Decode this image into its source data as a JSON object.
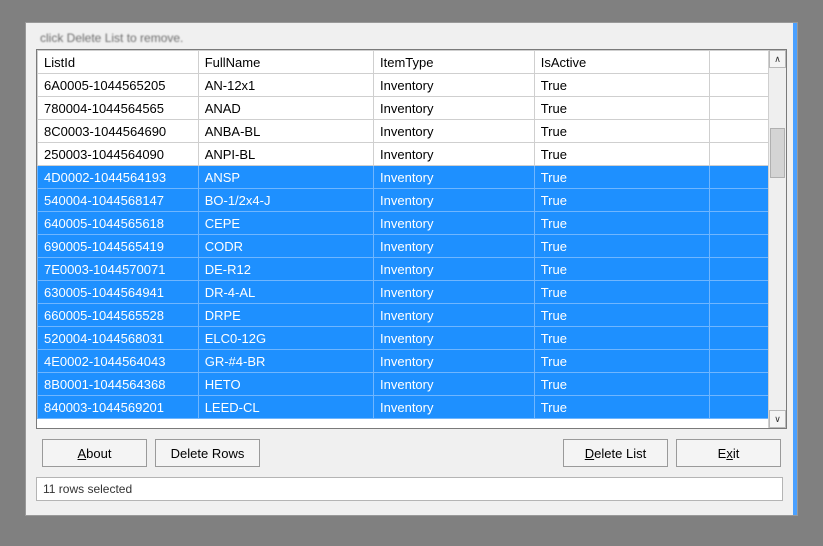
{
  "top_note": "click Delete List to remove.",
  "columns": {
    "listid": "ListId",
    "fullname": "FullName",
    "itemtype": "ItemType",
    "isactive": "IsActive"
  },
  "rows": [
    {
      "listid": "6A0005-1044565205",
      "fullname": "AN-12x1",
      "itemtype": "Inventory",
      "isactive": "True",
      "selected": false
    },
    {
      "listid": "780004-1044564565",
      "fullname": "ANAD",
      "itemtype": "Inventory",
      "isactive": "True",
      "selected": false
    },
    {
      "listid": "8C0003-1044564690",
      "fullname": "ANBA-BL",
      "itemtype": "Inventory",
      "isactive": "True",
      "selected": false
    },
    {
      "listid": "250003-1044564090",
      "fullname": "ANPI-BL",
      "itemtype": "Inventory",
      "isactive": "True",
      "selected": false
    },
    {
      "listid": "4D0002-1044564193",
      "fullname": "ANSP",
      "itemtype": "Inventory",
      "isactive": "True",
      "selected": true
    },
    {
      "listid": "540004-1044568147",
      "fullname": "BO-1/2x4-J",
      "itemtype": "Inventory",
      "isactive": "True",
      "selected": true
    },
    {
      "listid": "640005-1044565618",
      "fullname": "CEPE",
      "itemtype": "Inventory",
      "isactive": "True",
      "selected": true
    },
    {
      "listid": "690005-1044565419",
      "fullname": "CODR",
      "itemtype": "Inventory",
      "isactive": "True",
      "selected": true
    },
    {
      "listid": "7E0003-1044570071",
      "fullname": "DE-R12",
      "itemtype": "Inventory",
      "isactive": "True",
      "selected": true
    },
    {
      "listid": "630005-1044564941",
      "fullname": "DR-4-AL",
      "itemtype": "Inventory",
      "isactive": "True",
      "selected": true
    },
    {
      "listid": "660005-1044565528",
      "fullname": "DRPE",
      "itemtype": "Inventory",
      "isactive": "True",
      "selected": true
    },
    {
      "listid": "520004-1044568031",
      "fullname": "ELC0-12G",
      "itemtype": "Inventory",
      "isactive": "True",
      "selected": true
    },
    {
      "listid": "4E0002-1044564043",
      "fullname": "GR-#4-BR",
      "itemtype": "Inventory",
      "isactive": "True",
      "selected": true
    },
    {
      "listid": "8B0001-1044564368",
      "fullname": "HETO",
      "itemtype": "Inventory",
      "isactive": "True",
      "selected": true
    },
    {
      "listid": "840003-1044569201",
      "fullname": "LEED-CL",
      "itemtype": "Inventory",
      "isactive": "True",
      "selected": true
    }
  ],
  "buttons": {
    "about": "About",
    "delete_rows": "Delete Rows",
    "delete_list": "Delete List",
    "exit": "Exit"
  },
  "status": "11 rows selected",
  "scroll": {
    "up": "∧",
    "down": "∨"
  }
}
